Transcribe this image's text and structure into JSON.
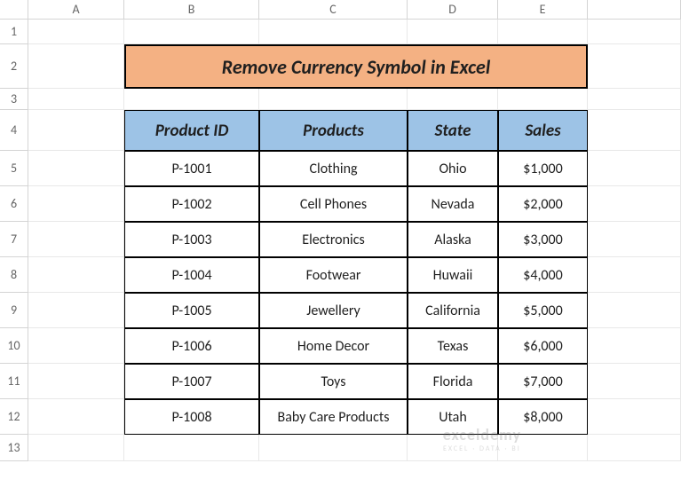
{
  "columns": [
    "A",
    "B",
    "C",
    "D",
    "E"
  ],
  "rows": [
    "1",
    "2",
    "3",
    "4",
    "5",
    "6",
    "7",
    "8",
    "9",
    "10",
    "11",
    "12",
    "13"
  ],
  "title": "Remove Currency Symbol in Excel",
  "headers": {
    "product_id": "Product ID",
    "products": "Products",
    "state": "State",
    "sales": "Sales"
  },
  "data": [
    {
      "product_id": "P-1001",
      "products": "Clothing",
      "state": "Ohio",
      "sales": "$1,000"
    },
    {
      "product_id": "P-1002",
      "products": "Cell Phones",
      "state": "Nevada",
      "sales": "$2,000"
    },
    {
      "product_id": "P-1003",
      "products": "Electronics",
      "state": "Alaska",
      "sales": "$3,000"
    },
    {
      "product_id": "P-1004",
      "products": "Footwear",
      "state": "Huwaii",
      "sales": "$4,000"
    },
    {
      "product_id": "P-1005",
      "products": "Jewellery",
      "state": "California",
      "sales": "$5,000"
    },
    {
      "product_id": "P-1006",
      "products": "Home Decor",
      "state": "Texas",
      "sales": "$6,000"
    },
    {
      "product_id": "P-1007",
      "products": "Toys",
      "state": "Florida",
      "sales": "$7,000"
    },
    {
      "product_id": "P-1008",
      "products": "Baby Care Products",
      "state": "Utah",
      "sales": "$8,000"
    }
  ],
  "watermark": {
    "brand": "exceldemy",
    "tag": "EXCEL · DATA · BI"
  },
  "chart_data": {
    "type": "table",
    "title": "Remove Currency Symbol in Excel",
    "columns": [
      "Product ID",
      "Products",
      "State",
      "Sales"
    ],
    "rows": [
      [
        "P-1001",
        "Clothing",
        "Ohio",
        "$1,000"
      ],
      [
        "P-1002",
        "Cell Phones",
        "Nevada",
        "$2,000"
      ],
      [
        "P-1003",
        "Electronics",
        "Alaska",
        "$3,000"
      ],
      [
        "P-1004",
        "Footwear",
        "Huwaii",
        "$4,000"
      ],
      [
        "P-1005",
        "Jewellery",
        "California",
        "$5,000"
      ],
      [
        "P-1006",
        "Home Decor",
        "Texas",
        "$6,000"
      ],
      [
        "P-1007",
        "Toys",
        "Florida",
        "$7,000"
      ],
      [
        "P-1008",
        "Baby Care Products",
        "Utah",
        "$8,000"
      ]
    ]
  }
}
